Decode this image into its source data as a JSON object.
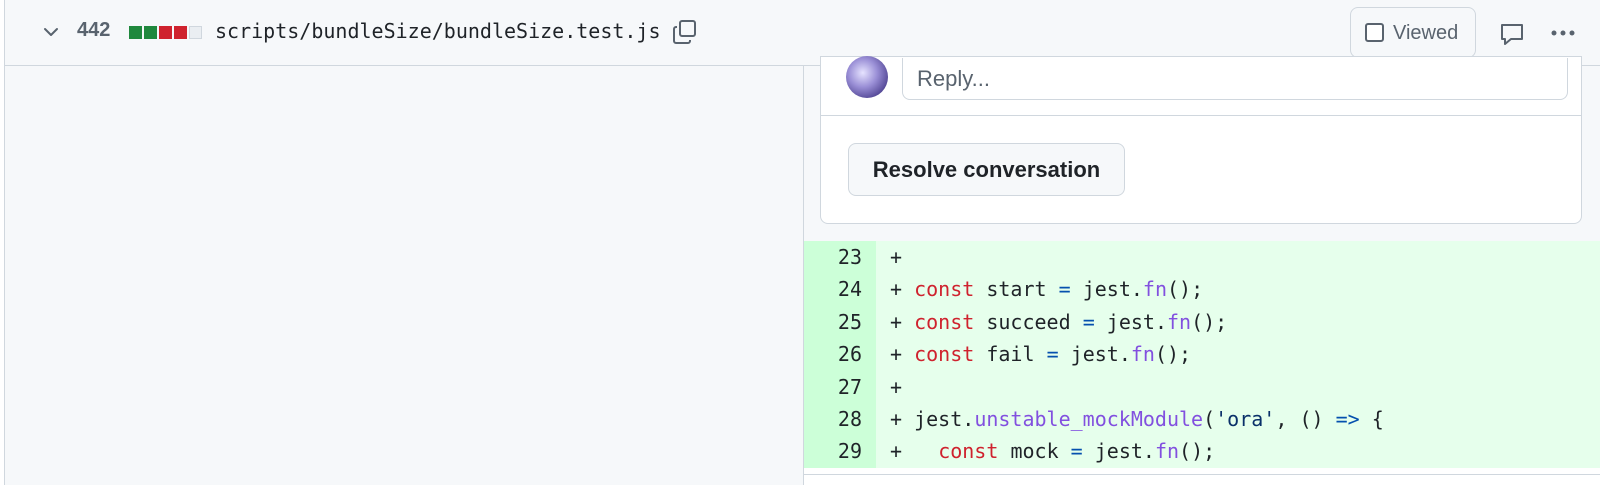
{
  "file_header": {
    "changes_count": "442",
    "file_path": "scripts/bundleSize/bundleSize.test.js",
    "viewed_label": "Viewed",
    "diffstat": [
      "added",
      "added",
      "deleted",
      "deleted",
      "neutral"
    ]
  },
  "colors": {
    "added": "#1f883d",
    "deleted": "#cf222e",
    "neutral": "#eaeef2",
    "added_line_bg": "#e6ffec",
    "added_num_bg": "#ccffd8"
  },
  "thread": {
    "reply_placeholder": "Reply...",
    "resolve_label": "Resolve conversation"
  },
  "diff_lines": [
    {
      "num": "23",
      "sign": "+",
      "tokens": []
    },
    {
      "num": "24",
      "sign": "+",
      "tokens": [
        {
          "t": "const",
          "c": "kw"
        },
        {
          "t": " start "
        },
        {
          "t": "=",
          "c": "op"
        },
        {
          "t": " jest."
        },
        {
          "t": "fn",
          "c": "fn"
        },
        {
          "t": "();"
        }
      ]
    },
    {
      "num": "25",
      "sign": "+",
      "tokens": [
        {
          "t": "const",
          "c": "kw"
        },
        {
          "t": " succeed "
        },
        {
          "t": "=",
          "c": "op"
        },
        {
          "t": " jest."
        },
        {
          "t": "fn",
          "c": "fn"
        },
        {
          "t": "();"
        }
      ]
    },
    {
      "num": "26",
      "sign": "+",
      "tokens": [
        {
          "t": "const",
          "c": "kw"
        },
        {
          "t": " fail "
        },
        {
          "t": "=",
          "c": "op"
        },
        {
          "t": " jest."
        },
        {
          "t": "fn",
          "c": "fn"
        },
        {
          "t": "();"
        }
      ]
    },
    {
      "num": "27",
      "sign": "+",
      "tokens": []
    },
    {
      "num": "28",
      "sign": "+",
      "tokens": [
        {
          "t": "jest."
        },
        {
          "t": "unstable_mockModule",
          "c": "fn"
        },
        {
          "t": "("
        },
        {
          "t": "'ora'",
          "c": "str"
        },
        {
          "t": ", () "
        },
        {
          "t": "=>",
          "c": "op"
        },
        {
          "t": " {"
        }
      ]
    },
    {
      "num": "29",
      "sign": "+",
      "tokens": [
        {
          "t": "  "
        },
        {
          "t": "const",
          "c": "kw"
        },
        {
          "t": " mock "
        },
        {
          "t": "=",
          "c": "op"
        },
        {
          "t": " jest."
        },
        {
          "t": "fn",
          "c": "fn"
        },
        {
          "t": "();"
        }
      ]
    }
  ]
}
